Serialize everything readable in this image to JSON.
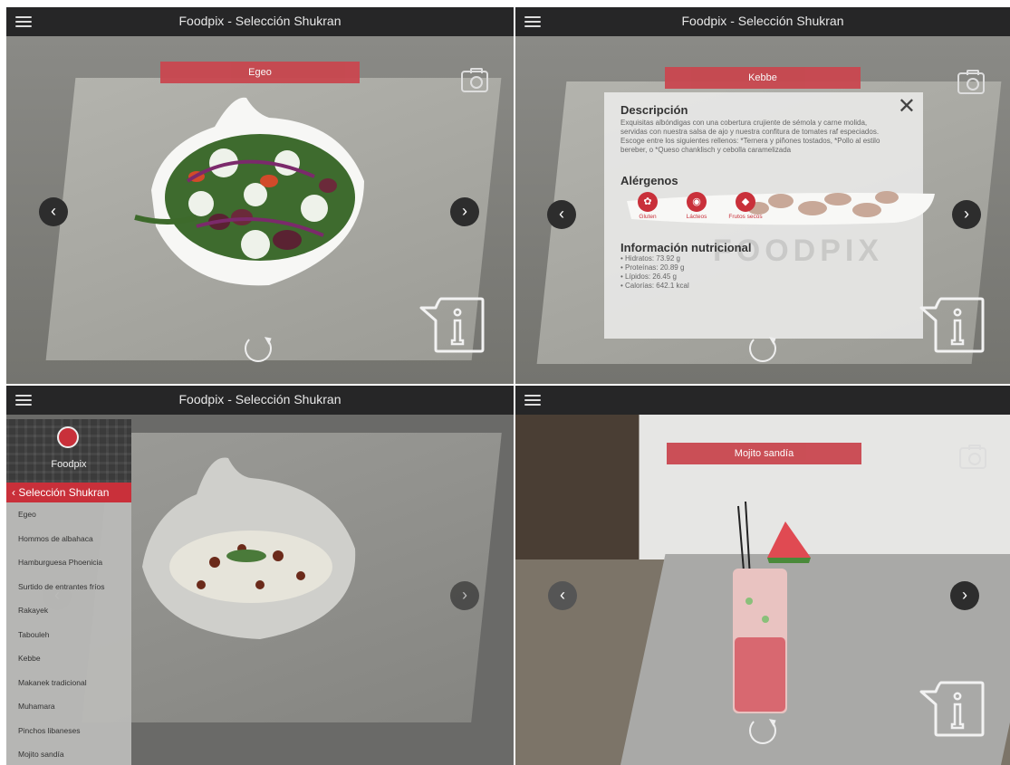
{
  "app": {
    "title": "Foodpix - Selección Shukran",
    "brand": "Foodpix"
  },
  "icons": {
    "menu": "hamburger-icon",
    "camera": "camera-icon",
    "prev": "chevron-left-icon",
    "next": "chevron-right-icon",
    "rotate": "rotate-icon",
    "info": "info-icon",
    "close": "close-icon"
  },
  "colors": {
    "accent": "#c9474f",
    "appbar": "#262627"
  },
  "panel1": {
    "dish": "Egeo"
  },
  "panel2": {
    "dish": "Kebbe",
    "watermark": "FOODPIX",
    "description_title": "Descripción",
    "description": "Exquisitas albóndigas con una cobertura crujiente de sémola y carne molida, servidas con nuestra salsa de ajo y nuestra confitura de tomates raf especiados. Escoge entre los siguientes rellenos: *Ternera y piñones tostados, *Pollo al estilo bereber, o *Queso chanklisch y cebolla caramelizada",
    "allergens_title": "Alérgenos",
    "allergens": [
      "Gluten",
      "Lácteos",
      "Frutos secos"
    ],
    "nutrition_title": "Información nutricional",
    "nutrition": [
      "• Hidratos: 73.92 g",
      "• Proteínas: 20.89 g",
      "• Lípidos: 26.45 g",
      "• Calorías: 642.1 kcal"
    ]
  },
  "panel3": {
    "menu_section": "Selección Shukran",
    "menu_items": [
      "Egeo",
      "Hommos de albahaca",
      "Hamburguesa Phoenicia",
      "Surtido de entrantes fríos",
      "Rakayek",
      "Tabouleh",
      "Kebbe",
      "Makanek tradicional",
      "Muhamara",
      "Pinchos libaneses",
      "Mojito sandía"
    ]
  },
  "panel4": {
    "dish": "Mojito sandía"
  }
}
